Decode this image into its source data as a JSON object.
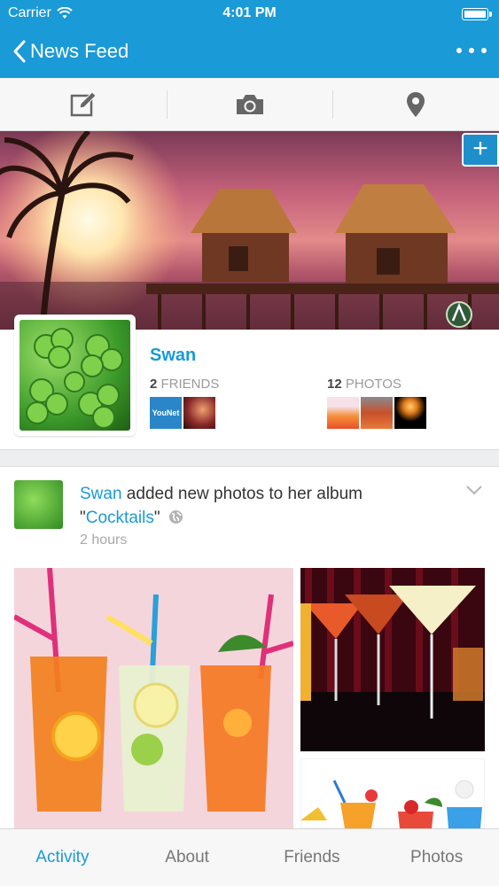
{
  "status_bar": {
    "carrier": "Carrier",
    "time": "4:01 PM"
  },
  "nav": {
    "back_label": "News Feed"
  },
  "profile": {
    "name": "Swan",
    "friends_count": "2",
    "friends_label": "FRIENDS",
    "photos_count": "12",
    "photos_label": "PHOTOS",
    "friend_badge_text": "YouNet"
  },
  "post": {
    "author": "Swan",
    "action_text": " added new photos to her album",
    "album_quote_open": "\"",
    "album_name": "Cocktails",
    "album_quote_close": "\"",
    "time": "2 hours"
  },
  "tabs": [
    {
      "label": "Activity",
      "active": true
    },
    {
      "label": "About",
      "active": false
    },
    {
      "label": "Friends",
      "active": false
    },
    {
      "label": "Photos",
      "active": false
    }
  ],
  "icons": {
    "back": "chevron-left-icon",
    "more": "more-dots-icon",
    "compose": "compose-icon",
    "camera": "camera-icon",
    "location": "location-pin-icon",
    "add": "plus-icon",
    "privacy": "globe-icon",
    "post_menu": "chevron-down-icon"
  },
  "colors": {
    "brand": "#1a9ad6",
    "tab_active": "#1a9ad6",
    "text_muted": "#9a9a9a"
  }
}
